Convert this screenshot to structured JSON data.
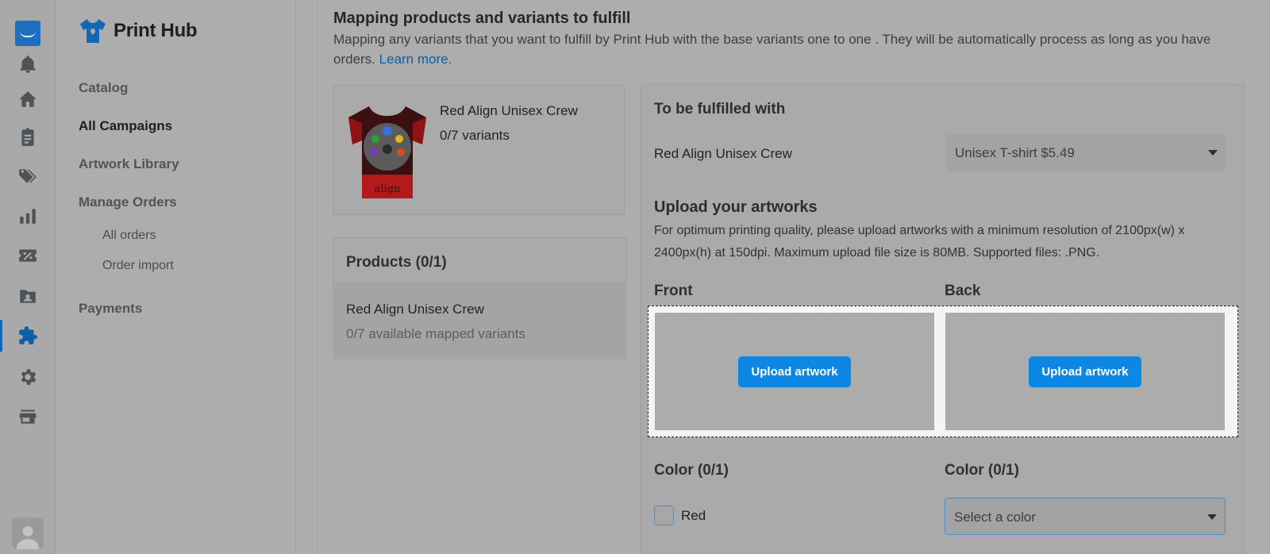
{
  "rail": {
    "items": [
      {
        "name": "bell-icon"
      },
      {
        "name": "home-icon"
      },
      {
        "name": "clipboard-icon"
      },
      {
        "name": "tags-icon"
      },
      {
        "name": "bar-chart-icon"
      },
      {
        "name": "percent-ticket-icon"
      },
      {
        "name": "contact-folder-icon"
      },
      {
        "name": "puzzle-icon",
        "active": true
      },
      {
        "name": "gear-icon"
      },
      {
        "name": "store-icon"
      }
    ]
  },
  "nav": {
    "brand": "Print Hub",
    "catalog": "Catalog",
    "all_campaigns": "All Campaigns",
    "artwork_library": "Artwork Library",
    "manage_orders": "Manage Orders",
    "all_orders": "All orders",
    "order_import": "Order import",
    "payments": "Payments"
  },
  "header": {
    "title": "Mapping products and variants to fulfill",
    "desc": "Mapping any variants that you want to fulfill by Print Hub with the base variants one to one . They will be automatically process as long as you have orders.",
    "learn_more": "Learn more."
  },
  "product": {
    "name": "Red Align Unisex Crew",
    "variants": "0/7 variants",
    "tee_text": "align"
  },
  "products_list": {
    "title": "Products (0/1)",
    "item_name": "Red Align Unisex Crew",
    "item_sub": "0/7 available mapped variants"
  },
  "fulfill": {
    "title": "To be fulfilled with",
    "product_name": "Red Align Unisex Crew",
    "base_select": "Unisex T-shirt $5.49",
    "upload_title": "Upload your artworks",
    "upload_desc": "For optimum printing quality, please upload artworks with a minimum resolution of 2100px(w) x 2400px(h) at 150dpi. Maximum upload file size is 80MB. Supported files: .PNG.",
    "front": "Front",
    "back": "Back",
    "upload_btn": "Upload artwork",
    "color_front": "Color (0/1)",
    "color_back": "Color (0/1)",
    "color_option": "Red",
    "color_placeholder": "Select a color"
  },
  "colors": {
    "accent": "#0d87e4",
    "brand": "#1566b6",
    "overlay": "#adadad"
  }
}
